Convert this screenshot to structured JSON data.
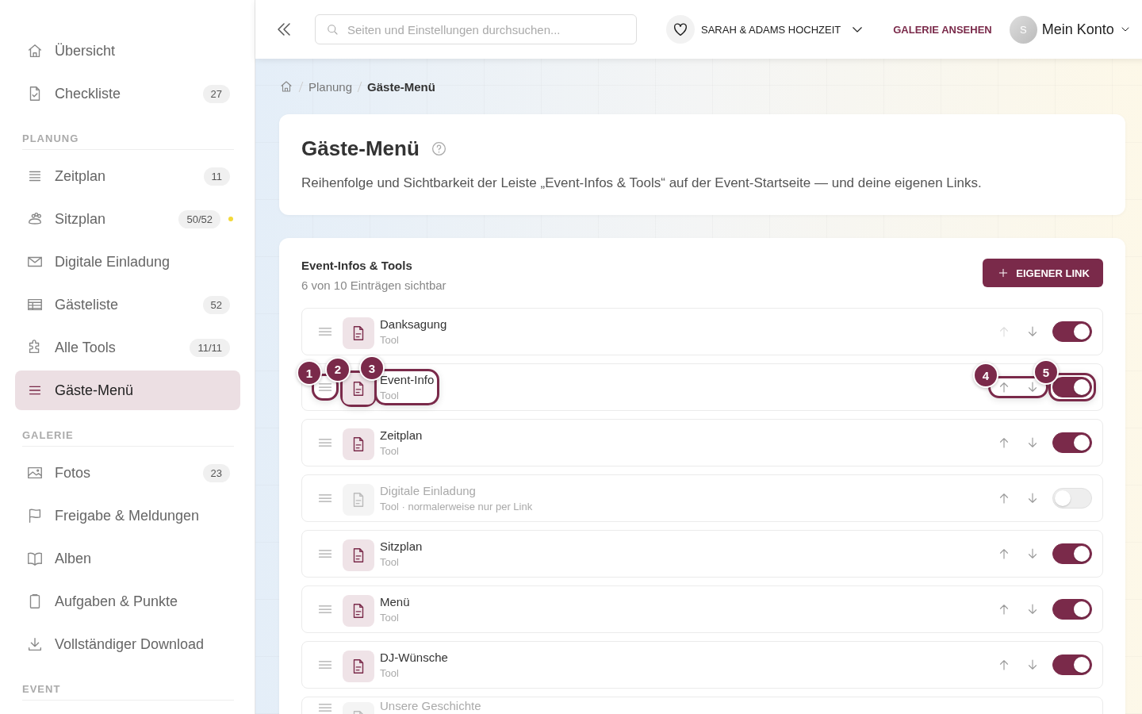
{
  "sidebar": {
    "top_items": [
      {
        "label": "Übersicht",
        "selected": false
      },
      {
        "label": "Checkliste",
        "badge": "27",
        "selected": false
      }
    ],
    "sections": [
      {
        "title": "PLANUNG",
        "items": [
          {
            "label": "Zeitplan",
            "badge": "11",
            "selected": false
          },
          {
            "label": "Sitzplan",
            "badge": "50/52",
            "status_dot": true,
            "selected": false
          },
          {
            "label": "Digitale Einladung",
            "selected": false
          },
          {
            "label": "Gästeliste",
            "badge": "52",
            "selected": false
          },
          {
            "label": "Alle Tools",
            "badge": "11/11",
            "selected": false
          },
          {
            "label": "Gäste-Menü",
            "selected": true
          }
        ]
      },
      {
        "title": "GALERIE",
        "items": [
          {
            "label": "Fotos",
            "badge": "23",
            "selected": false
          },
          {
            "label": "Freigabe & Meldungen",
            "selected": false
          },
          {
            "label": "Alben",
            "selected": false
          },
          {
            "label": "Aufgaben & Punkte",
            "selected": false
          },
          {
            "label": "Vollständiger Download",
            "selected": false
          }
        ]
      },
      {
        "title": "EVENT"
      }
    ]
  },
  "topbar": {
    "search": {
      "placeholder": "Seiten und Einstellungen durchsuchen..."
    },
    "event": "SARAH & ADAMS HOCHZEIT",
    "gallery_link": "GALERIE ANSEHEN",
    "avatar": "S",
    "account": "Mein Konto"
  },
  "breadcrumb": [
    "Planung",
    "Gäste-Menü"
  ],
  "header": {
    "title": "Gäste-Menü",
    "description": "Reihenfolge und Sichtbarkeit der Leiste „Event-Infos & Tools“ auf der Event-Startseite — und deine eigenen Links."
  },
  "tools": {
    "title": "Event-Infos & Tools",
    "subtitle": "6 von 10 Einträgen sichtbar",
    "add_button": "EIGENER LINK",
    "rows": [
      {
        "name": "Danksagung",
        "type": "Tool",
        "on": true,
        "up_disabled": true
      },
      {
        "name": "Event-Info",
        "type": "Tool",
        "on": true,
        "up_disabled": false,
        "callouts": {
          "handle": "1",
          "icon": "2",
          "text": "3",
          "move": "4",
          "toggle": "5"
        }
      },
      {
        "name": "Zeitplan",
        "type": "Tool",
        "on": true,
        "up_disabled": false
      },
      {
        "name": "Digitale Einladung",
        "type": "Tool · normalerweise nur per Link",
        "on": false,
        "up_disabled": false
      },
      {
        "name": "Sitzplan",
        "type": "Tool",
        "on": true,
        "up_disabled": false
      },
      {
        "name": "Menü",
        "type": "Tool",
        "on": true,
        "up_disabled": false
      },
      {
        "name": "DJ-Wünsche",
        "type": "Tool",
        "on": true,
        "up_disabled": false
      },
      {
        "name": "Unsere Geschichte"
      }
    ]
  }
}
